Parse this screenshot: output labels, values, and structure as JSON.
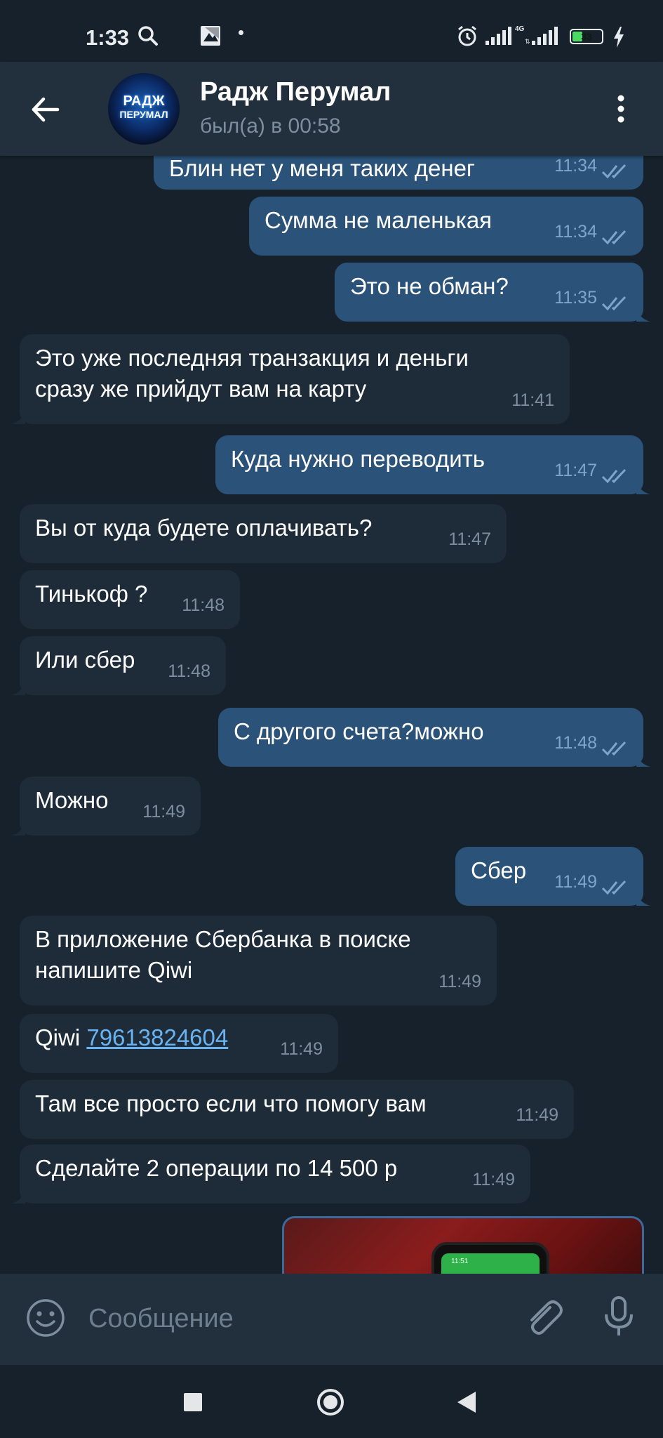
{
  "status_bar": {
    "time": "1:33",
    "battery": "33",
    "network": "4G",
    "icons": [
      "search-icon",
      "gallery-icon",
      "alarm-icon",
      "signal-icon",
      "battery-icon",
      "charging-icon"
    ]
  },
  "header": {
    "contact_name": "Радж Перумал",
    "last_seen": "был(а) в 00:58",
    "avatar_line1": "РАДЖ",
    "avatar_line2": "ПЕРУМАЛ"
  },
  "messages": [
    {
      "dir": "out",
      "text": "Блин нет у меня таких денег",
      "time": "11:34",
      "read": true
    },
    {
      "dir": "out",
      "text": "Сумма не маленькая",
      "time": "11:34",
      "read": true
    },
    {
      "dir": "out",
      "text": "Это не обман?",
      "time": "11:35",
      "read": true
    },
    {
      "dir": "in",
      "text": "Это уже последняя транзакция и деньги сразу же прийдут вам на карту",
      "time": "11:41"
    },
    {
      "dir": "out",
      "text": "Куда нужно переводить",
      "time": "11:47",
      "read": true
    },
    {
      "dir": "in",
      "text": "Вы от куда будете оплачивать?",
      "time": "11:47"
    },
    {
      "dir": "in",
      "text": "Тинькоф ?",
      "time": "11:48"
    },
    {
      "dir": "in",
      "text": "Или сбер",
      "time": "11:48"
    },
    {
      "dir": "out",
      "text": "С другого счета?можно",
      "time": "11:48",
      "read": true
    },
    {
      "dir": "in",
      "text": "Можно",
      "time": "11:49"
    },
    {
      "dir": "out",
      "text": "Сбер",
      "time": "11:49",
      "read": true
    },
    {
      "dir": "in",
      "text": "В приложение Сбербанка в поиске напишите Qiwi",
      "time": "11:49"
    },
    {
      "dir": "in",
      "text_prefix": "Qiwi",
      "link": "79613824604",
      "time": "11:49"
    },
    {
      "dir": "in",
      "text": "Там все просто если что помогу вам",
      "time": "11:49"
    },
    {
      "dir": "in",
      "text": "Сделайте 2 операции по 14 500 р",
      "time": "11:49"
    }
  ],
  "photo_message": {
    "thumb_time": "11:51"
  },
  "input": {
    "placeholder": "Сообщение"
  },
  "colors": {
    "background": "#17212b",
    "header": "#222f3c",
    "outgoing_bubble": "#2b5278",
    "incoming_bubble": "#1e2c3a",
    "link": "#6ab3f3"
  }
}
